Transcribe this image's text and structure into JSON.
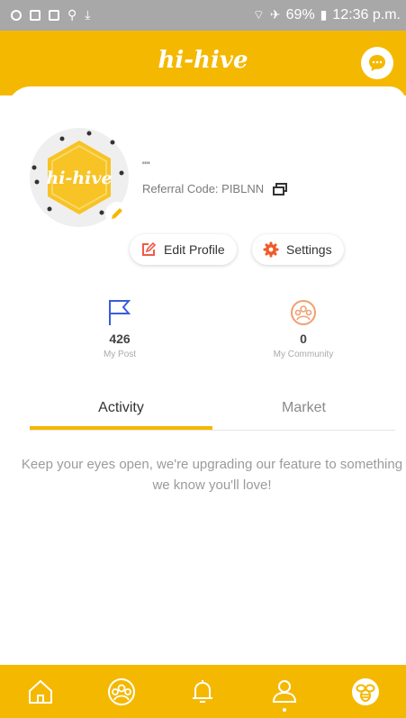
{
  "status_bar": {
    "battery": "69%",
    "time": "12:36 p.m."
  },
  "app": {
    "brand": "hi-hive",
    "avatar_text": "hi-hive"
  },
  "profile": {
    "username": "\"\"",
    "referral": "Referral Code: PIBLNN"
  },
  "actions": {
    "edit_label": "Edit Profile",
    "settings_label": "Settings"
  },
  "stats": {
    "post_value": "426",
    "post_label": "My Post",
    "community_value": "0",
    "community_label": "My Community"
  },
  "tabs": {
    "activity": "Activity",
    "market": "Market"
  },
  "notice": "Keep your eyes open, we're upgrading our feature to something we know you'll love!",
  "colors": {
    "accent": "#f5b800",
    "edit_icon": "#f05a4a",
    "settings_icon": "#f05a2a",
    "post_icon": "#3b5bdb",
    "community_icon": "#f0a070"
  },
  "icons": {
    "chat": "chat-bubble-icon",
    "nav": [
      "home-icon",
      "community-icon",
      "bell-icon",
      "profile-icon",
      "bee-icon"
    ]
  }
}
